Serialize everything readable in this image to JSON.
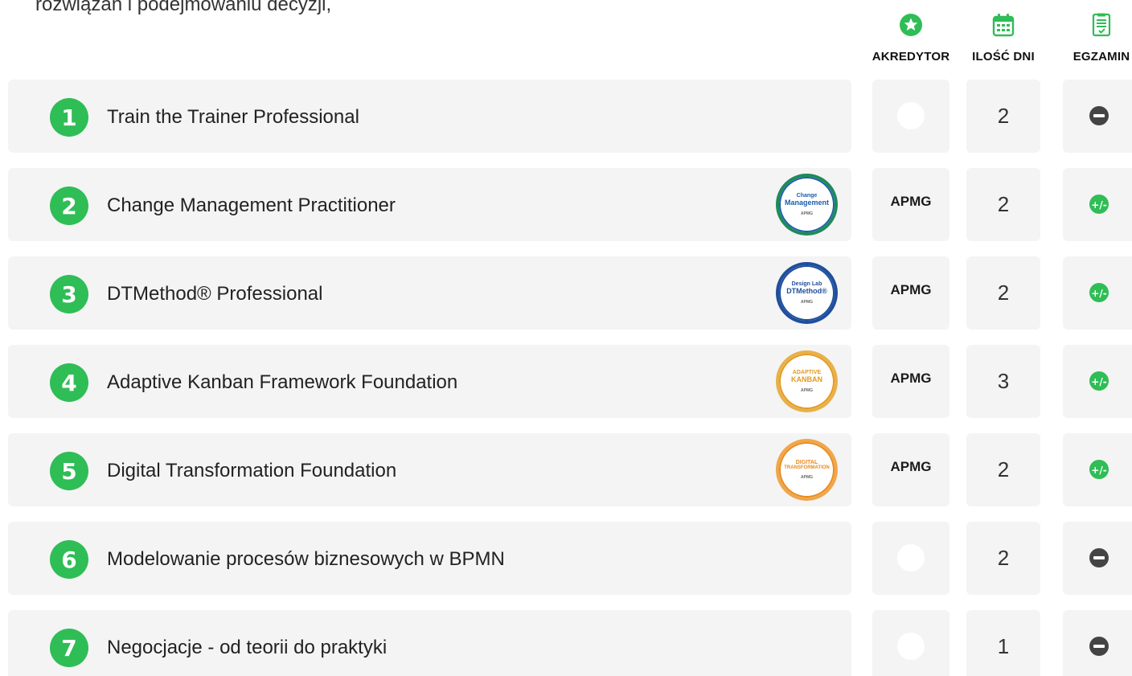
{
  "intro_text": "rozwiązań i podejmowaniu decyzji,",
  "headers": {
    "akredytor": "AKREDYTOR",
    "ilosc_dni": "ILOŚĆ DNI",
    "egzamin": "EGZAMIN"
  },
  "header_icons": {
    "akredytor": "star-icon",
    "ilosc_dni": "calendar-icon",
    "egzamin": "exam-sheet-icon"
  },
  "colors": {
    "accent_green": "#2fbd56",
    "exam_none": "#444444",
    "card_bg": "#f4f4f4"
  },
  "courses": [
    {
      "number": "1",
      "title": "Train the Trainer Professional",
      "badge": null,
      "akredytor": "",
      "days": "2",
      "exam": "none"
    },
    {
      "number": "2",
      "title": "Change Management Practitioner",
      "badge": {
        "line1": "Change",
        "line2": "Management",
        "sub": "APMG",
        "ring": "#1e8a5a",
        "inner": "#1c5fa8"
      },
      "akredytor": "APMG",
      "days": "2",
      "exam": "plus-minus"
    },
    {
      "number": "3",
      "title": "DTMethod® Professional",
      "badge": {
        "line1": "Design Lab",
        "line2": "DTMethod®",
        "sub": "APMG",
        "ring": "#1f4e9c",
        "inner": "#1f4e9c"
      },
      "akredytor": "APMG",
      "days": "2",
      "exam": "plus-minus"
    },
    {
      "number": "4",
      "title": "Adaptive Kanban Framework Foundation",
      "badge": {
        "line1": "ADAPTIVE",
        "line2": "KANBAN",
        "sub": "APMG",
        "ring": "#e8b04a",
        "inner": "#e59a1c"
      },
      "akredytor": "APMG",
      "days": "3",
      "exam": "plus-minus"
    },
    {
      "number": "5",
      "title": "Digital Transformation Foundation",
      "badge": {
        "line1": "DIGITAL",
        "line2": "TRANSFORMATION",
        "sub": "APMG",
        "ring": "#f0a64a",
        "inner": "#e88a1c"
      },
      "akredytor": "APMG",
      "days": "2",
      "exam": "plus-minus"
    },
    {
      "number": "6",
      "title": "Modelowanie procesów biznesowych w BPMN",
      "badge": null,
      "akredytor": "",
      "days": "2",
      "exam": "none"
    },
    {
      "number": "7",
      "title": "Negocjacje - od teorii do praktyki",
      "badge": null,
      "akredytor": "",
      "days": "1",
      "exam": "none"
    }
  ]
}
